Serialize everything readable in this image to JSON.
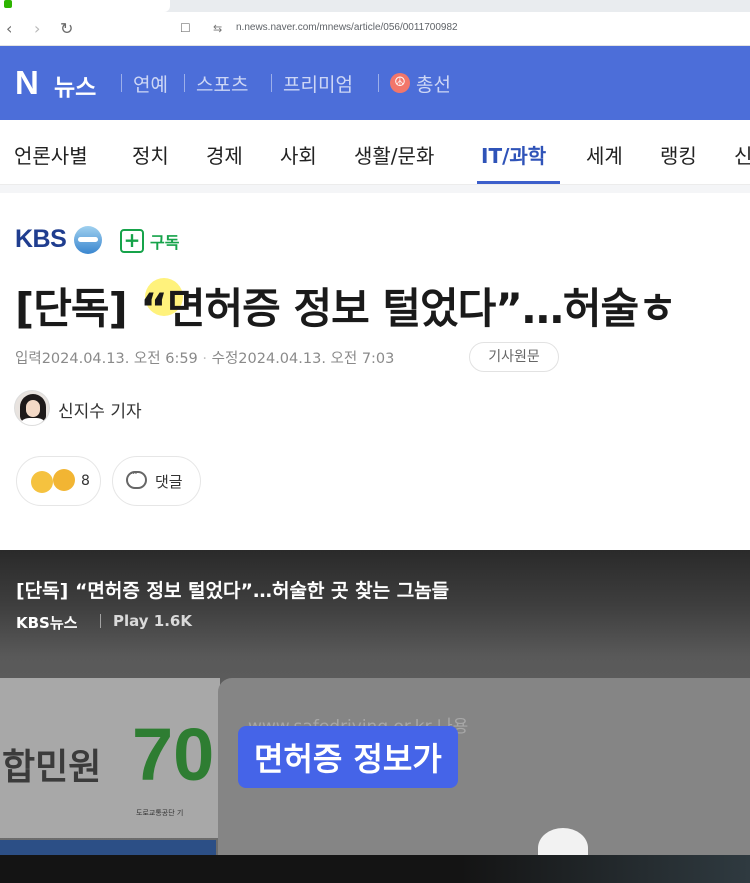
{
  "browser": {
    "url": "n.news.naver.com/mnews/article/056/0011700982",
    "back_icon": "chevron-left",
    "forward_icon": "chevron-right",
    "reload_icon": "reload"
  },
  "brand_bar": {
    "logo_letter": "N",
    "logo_text": "뉴스",
    "items": [
      "연예",
      "스포츠",
      "프리미엄",
      "총선"
    ],
    "bg_color": "#4c6ed9"
  },
  "categories": {
    "items": [
      "언론사별",
      "정치",
      "경제",
      "사회",
      "생활/문화",
      "IT/과학",
      "세계",
      "랭킹",
      "신"
    ],
    "active": "IT/과학",
    "active_color": "#2f53b8"
  },
  "article": {
    "press_logo": "KBS",
    "subscribe_label": "구독",
    "headline": "[단독] “면허증 정보 털었다”…허술ㅎ",
    "meta": {
      "input_label": "입력",
      "input_date": "2024.04.13. 오전 6:59",
      "sep": "·",
      "modified_label": "수정",
      "modified_date": "2024.04.13. 오전 7:03"
    },
    "original_button": "기사원문",
    "reporter": "신지수 기자",
    "reaction_count": "8",
    "comment_label": "댓글"
  },
  "video": {
    "title": "[단독] “면허증 정보 털었다”…허술한 곳 찾는 그놈들",
    "source": "KBS뉴스",
    "play": "Play 1.6K",
    "frame_left_text": "합민원",
    "frame_logo": "70",
    "frame_logo_sub": "도로교통공단 기",
    "faded_url": "www.safedriving.or.kr 나용",
    "caption": "면허증 정보가",
    "caption_color": "#4564e8"
  }
}
